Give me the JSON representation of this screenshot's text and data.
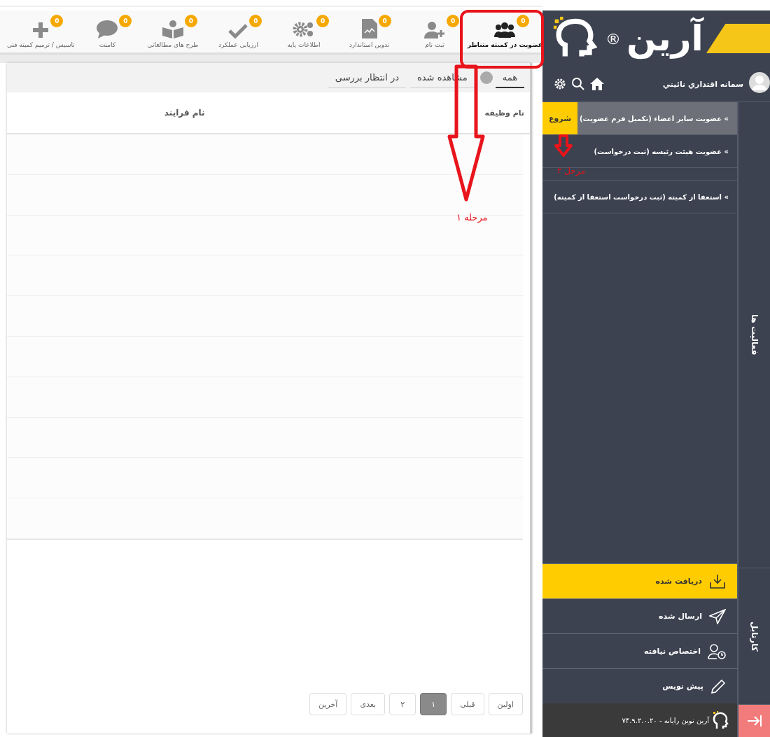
{
  "toolbar": {
    "items": [
      {
        "label": "عضویت در کمیته متناظر",
        "kind": "group",
        "badge": "0",
        "selected": true
      },
      {
        "label": "ثبت نام",
        "kind": "register",
        "badge": "0",
        "selected": false
      },
      {
        "label": "تدوین استاندارد",
        "kind": "document",
        "badge": "0",
        "selected": false
      },
      {
        "label": "اطلاعات پایه",
        "kind": "settings",
        "badge": "0",
        "selected": false
      },
      {
        "label": "ارزیابی عملکرد",
        "kind": "evaluation",
        "badge": "0",
        "selected": false
      },
      {
        "label": "طرح های مطالعاتی",
        "kind": "study",
        "badge": "0",
        "selected": false
      },
      {
        "label": "کامنت",
        "kind": "comment",
        "badge": "0",
        "selected": false
      },
      {
        "label": "تاسیس / ترمیم کمیته فنی",
        "kind": "create",
        "badge": "0",
        "selected": false
      }
    ]
  },
  "tabs": [
    {
      "label": "همه",
      "selected": true
    },
    {
      "label": "مشاهده شده",
      "selected": false
    },
    {
      "label": "در انتظار بررسی",
      "selected": false
    }
  ],
  "table": {
    "columns": [
      "نام وظیفه",
      "نام فرایند"
    ]
  },
  "pagination": [
    {
      "label": "اولین",
      "selected": false
    },
    {
      "label": "قبلی",
      "selected": false
    },
    {
      "label": "۱",
      "selected": true
    },
    {
      "label": "۲",
      "selected": false
    },
    {
      "label": "بعدی",
      "selected": false
    },
    {
      "label": "آخرین",
      "selected": false
    }
  ],
  "sidebar": {
    "logo": {
      "name": "آرین",
      "mark": "®"
    },
    "user": {
      "name": "سمانه اقتداري نائيني"
    },
    "processes": [
      {
        "label": "» عضویت سایر اعضاء (تکمیل فرم عضویت)",
        "selected": true,
        "action": "شروع"
      },
      {
        "label": "» عضویت هیئت رئیسه (ثبت درخواست)",
        "selected": false
      },
      {
        "label": "» استعفا از کمیته (ثبت درخواست استعفا از کمیته)",
        "selected": false
      }
    ],
    "rail": [
      "فعالیت ها",
      "کارتابل"
    ],
    "inbox": [
      {
        "label": "دریافت شده",
        "kind": "received",
        "selected": true
      },
      {
        "label": "ارسال شده",
        "kind": "sent",
        "selected": false
      },
      {
        "label": "اختصاص نیافته",
        "kind": "unassigned",
        "selected": false
      },
      {
        "label": "پیش نویس",
        "kind": "draft",
        "selected": false
      }
    ],
    "footer": "آرین نوین رایانه - ۷۴.۹.۲.۰.۲۰"
  },
  "annotations": [
    "مرحله ۱",
    "مرحل ۲"
  ]
}
